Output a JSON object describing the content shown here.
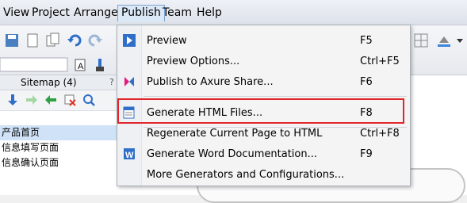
{
  "menubar": {
    "items": [
      "View",
      "Project",
      "Arrange",
      "Publish",
      "Team",
      "Help"
    ]
  },
  "sitemap": {
    "title": "Sitemap (4)",
    "help": "?",
    "pages": [
      "产品首页",
      "信息填写页面",
      "信息确认页面"
    ]
  },
  "publish_menu": {
    "items": [
      {
        "label": "Preview",
        "shortcut": "F5",
        "icon": "preview-play-icon"
      },
      {
        "label": "Preview Options...",
        "shortcut": "Ctrl+F5",
        "icon": ""
      },
      {
        "label": "Publish to Axure Share...",
        "shortcut": "F6",
        "icon": "axure-share-icon"
      },
      {
        "label": "Generate HTML Files...",
        "shortcut": "F8",
        "icon": "html-files-icon"
      },
      {
        "label": "Regenerate Current Page to HTML",
        "shortcut": "Ctrl+F8",
        "icon": ""
      },
      {
        "label": "Generate Word Documentation...",
        "shortcut": "F9",
        "icon": "word-doc-icon"
      },
      {
        "label": "More Generators and Configurations...",
        "shortcut": "",
        "icon": ""
      }
    ]
  },
  "colors": {
    "highlight": "#e0262b",
    "menu_active": "#dbe8f7",
    "selection": "#cfe2f7"
  }
}
